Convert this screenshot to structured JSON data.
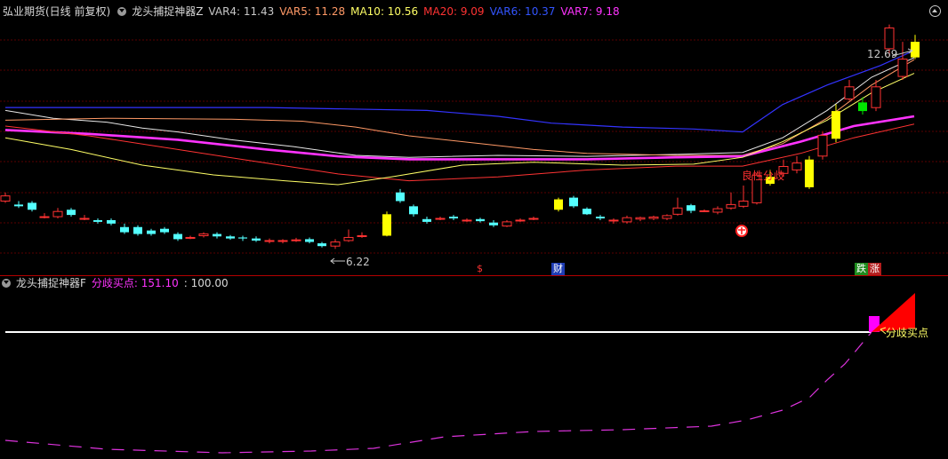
{
  "colors": {
    "background": "#000000",
    "up": "#ff3232",
    "down": "#54ffff",
    "accent": "#ff00ff"
  },
  "main_header": {
    "instrument": "弘业期货(日线 前复权)",
    "indicator": "龙头捕捉神器Z",
    "values": [
      {
        "label": "VAR4: 11.43",
        "color": "#c8c8c8"
      },
      {
        "label": "VAR5: 11.28",
        "color": "#ff9966"
      },
      {
        "label": "MA10: 10.56",
        "color": "#ffff66"
      },
      {
        "label": "MA20: 9.09",
        "color": "#ff3333"
      },
      {
        "label": "VAR6: 10.37",
        "color": "#3333ff"
      },
      {
        "label": "VAR7: 9.18",
        "color": "#ff33ff"
      }
    ]
  },
  "sub_header": {
    "indicator": "龙头捕捉神器F",
    "signal_label": "分歧买点: 151.10",
    "signal_color": "#ff33ff",
    "threshold": ": 100.00"
  },
  "annotations": {
    "high_price": "12.69",
    "low_price": "6.22",
    "signal_text": "良性分歧",
    "sub_signal_text": "分歧买点"
  },
  "markers": [
    {
      "text": "$",
      "color": "#ff3333"
    },
    {
      "text": "财",
      "color": "#ffffff",
      "bg": "#1e3cb4"
    },
    {
      "text": "跌",
      "color": "#ffffff",
      "bg": "#1e8c1e"
    },
    {
      "text": "涨",
      "color": "#ffffff",
      "bg": "#b41e1e"
    }
  ],
  "chart_data": [
    {
      "type": "candlestick",
      "title": "",
      "series": [
        {
          "name": "VAR4",
          "last": 11.43
        },
        {
          "name": "VAR5",
          "last": 11.28
        },
        {
          "name": "MA10",
          "last": 10.56
        },
        {
          "name": "MA20",
          "last": 9.09
        },
        {
          "name": "VAR6",
          "last": 10.37
        },
        {
          "name": "VAR7",
          "last": 9.18
        }
      ],
      "extremes": {
        "high": 12.69,
        "low": 6.22
      }
    },
    {
      "type": "line",
      "title": "",
      "series": [
        {
          "name": "分歧买点",
          "last": 151.1
        },
        {
          "name": "threshold",
          "last": 100.0
        }
      ]
    }
  ]
}
